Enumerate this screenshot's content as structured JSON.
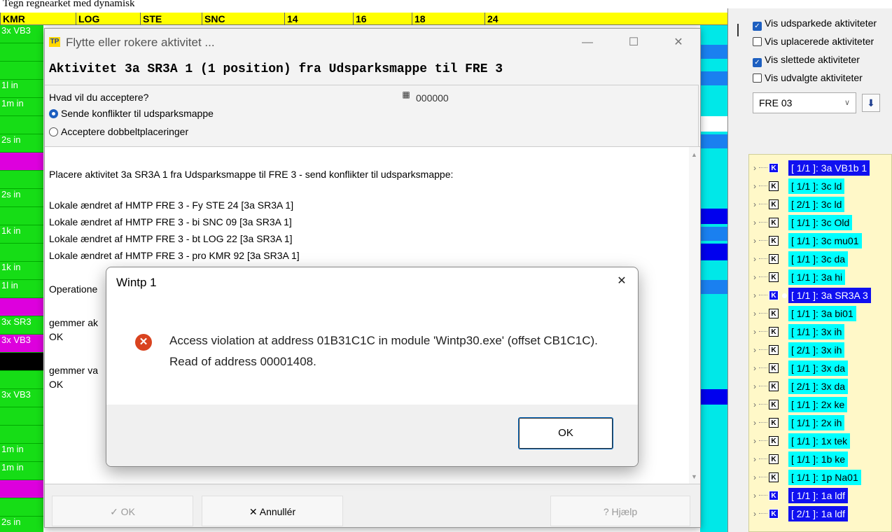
{
  "instruction": "Tegn regnearket med dynamisk",
  "grid": {
    "headers": [
      "KMR",
      "LOG",
      "STE",
      "SNC",
      "14",
      "16",
      "18",
      "24"
    ],
    "left_cells": [
      {
        "label": "3x VB3",
        "color": "#16dd16"
      },
      {
        "label": "",
        "color": "#16dd16"
      },
      {
        "label": "",
        "color": "#16dd16"
      },
      {
        "label": "1l in",
        "color": "#16dd16"
      },
      {
        "label": "1m in",
        "color": "#16dd16"
      },
      {
        "label": "",
        "color": "#16dd16"
      },
      {
        "label": "2s in",
        "color": "#16dd16"
      },
      {
        "label": "",
        "color": "#dd00dd"
      },
      {
        "label": "",
        "color": "#16dd16"
      },
      {
        "label": "2s in",
        "color": "#16dd16"
      },
      {
        "label": "",
        "color": "#16dd16"
      },
      {
        "label": "1k in",
        "color": "#16dd16"
      },
      {
        "label": "",
        "color": "#16dd16"
      },
      {
        "label": "1k in",
        "color": "#16dd16"
      },
      {
        "label": "1l in",
        "color": "#16dd16"
      },
      {
        "label": "",
        "color": "#dd00dd"
      },
      {
        "label": "3x SR3",
        "color": "#16dd16"
      },
      {
        "label": "3x VB3",
        "color": "#dd00dd"
      },
      {
        "label": "",
        "color": "#000000"
      },
      {
        "label": "",
        "color": "#16dd16"
      },
      {
        "label": "3x VB3",
        "color": "#16dd16"
      },
      {
        "label": "",
        "color": "#16dd16"
      },
      {
        "label": "",
        "color": "#16dd16"
      },
      {
        "label": "1m in",
        "color": "#16dd16"
      },
      {
        "label": "1m in",
        "color": "#16dd16"
      },
      {
        "label": "",
        "color": "#dd00dd"
      },
      {
        "label": "",
        "color": "#16dd16"
      },
      {
        "label": "2s in",
        "color": "#16dd16"
      }
    ]
  },
  "panel": {
    "checkboxes": [
      {
        "label": "Vis udsparkede aktiviteter",
        "checked": true
      },
      {
        "label": "Vis uplacerede aktiviteter",
        "checked": false
      },
      {
        "label": "Vis slettede aktiviteter",
        "checked": true
      },
      {
        "label": "Vis udvalgte aktiviteter",
        "checked": false
      }
    ],
    "select_value": "FRE 03",
    "tree": [
      {
        "label": "[ 1/1 ]: 3a VB1b 1",
        "style": "blue"
      },
      {
        "label": "[ 1/1 ]: 3c ld",
        "style": "cyan"
      },
      {
        "label": "[ 2/1 ]: 3c ld",
        "style": "cyan"
      },
      {
        "label": "[ 1/1 ]: 3c Old",
        "style": "cyan"
      },
      {
        "label": "[ 1/1 ]: 3c mu01",
        "style": "cyan"
      },
      {
        "label": "[ 1/1 ]: 3c da",
        "style": "cyan"
      },
      {
        "label": "[ 1/1 ]: 3a hi",
        "style": "cyan"
      },
      {
        "label": "[ 1/1 ]: 3a SR3A 3",
        "style": "blue",
        "selected": true
      },
      {
        "label": "[ 1/1 ]: 3a bi01",
        "style": "cyan"
      },
      {
        "label": "[ 1/1 ]: 3x ih",
        "style": "cyan"
      },
      {
        "label": "[ 2/1 ]: 3x ih",
        "style": "cyan"
      },
      {
        "label": "[ 1/1 ]: 3x da",
        "style": "cyan"
      },
      {
        "label": "[ 2/1 ]: 3x da",
        "style": "cyan"
      },
      {
        "label": "[ 1/1 ]: 2x ke",
        "style": "cyan"
      },
      {
        "label": "[ 1/1 ]: 2x ih",
        "style": "cyan"
      },
      {
        "label": "[ 1/1 ]: 1x tek",
        "style": "cyan"
      },
      {
        "label": "[ 1/1 ]: 1b ke",
        "style": "cyan"
      },
      {
        "label": "[ 1/1 ]: 1p Na01",
        "style": "cyan"
      },
      {
        "label": "[ 1/1 ]: 1a ldf",
        "style": "blue"
      },
      {
        "label": "[ 2/1 ]: 1a ldf",
        "style": "blue"
      }
    ]
  },
  "move_dialog": {
    "app_badge": "TP",
    "title": "Flytte eller rokere aktivitet ...",
    "heading": "Aktivitet 3a SR3A 1 (1 position) fra Udsparksmappe til FRE 3",
    "accept_label": "Hvad vil du acceptere?",
    "date_value": "000000",
    "radio_options": [
      {
        "label": "Sende konflikter til udsparksmappe",
        "selected": true
      },
      {
        "label": "Acceptere dobbeltplaceringer",
        "selected": false
      }
    ],
    "log_lines": [
      "Placere aktivitet 3a SR3A 1 fra Udsparksmappe til FRE 3 - send konflikter til udsparksmappe:",
      "Lokale ændret af HMTP FRE 3  -  Fy STE 24 [3a SR3A 1]",
      "Lokale ændret af HMTP FRE 3  -  bi SNC 09 [3a SR3A 1]",
      "Lokale ændret af HMTP FRE 3  -  bt LOG 22 [3a SR3A 1]",
      "Lokale ændret af HMTP FRE 3  -  pro KMR 92 [3a SR3A 1]",
      "Operatione",
      "gemmer ak",
      "OK",
      "gemmer va",
      "OK"
    ],
    "buttons": {
      "ok": "✓ OK",
      "cancel": "✕ Annullér",
      "help": "? Hjælp"
    }
  },
  "error_dialog": {
    "title": "Wintp 1",
    "message": "Access violation at address 01B31C1C in module 'Wintp30.exe' (offset CB1C1C). Read of address 00001408.",
    "ok_label": "OK"
  },
  "colors": {
    "cyan": "#00ffff",
    "blue": "#1010f0",
    "green": "#16dd16",
    "magenta": "#dd00dd",
    "accent": "#1d5fc0",
    "error": "#d9431f"
  }
}
